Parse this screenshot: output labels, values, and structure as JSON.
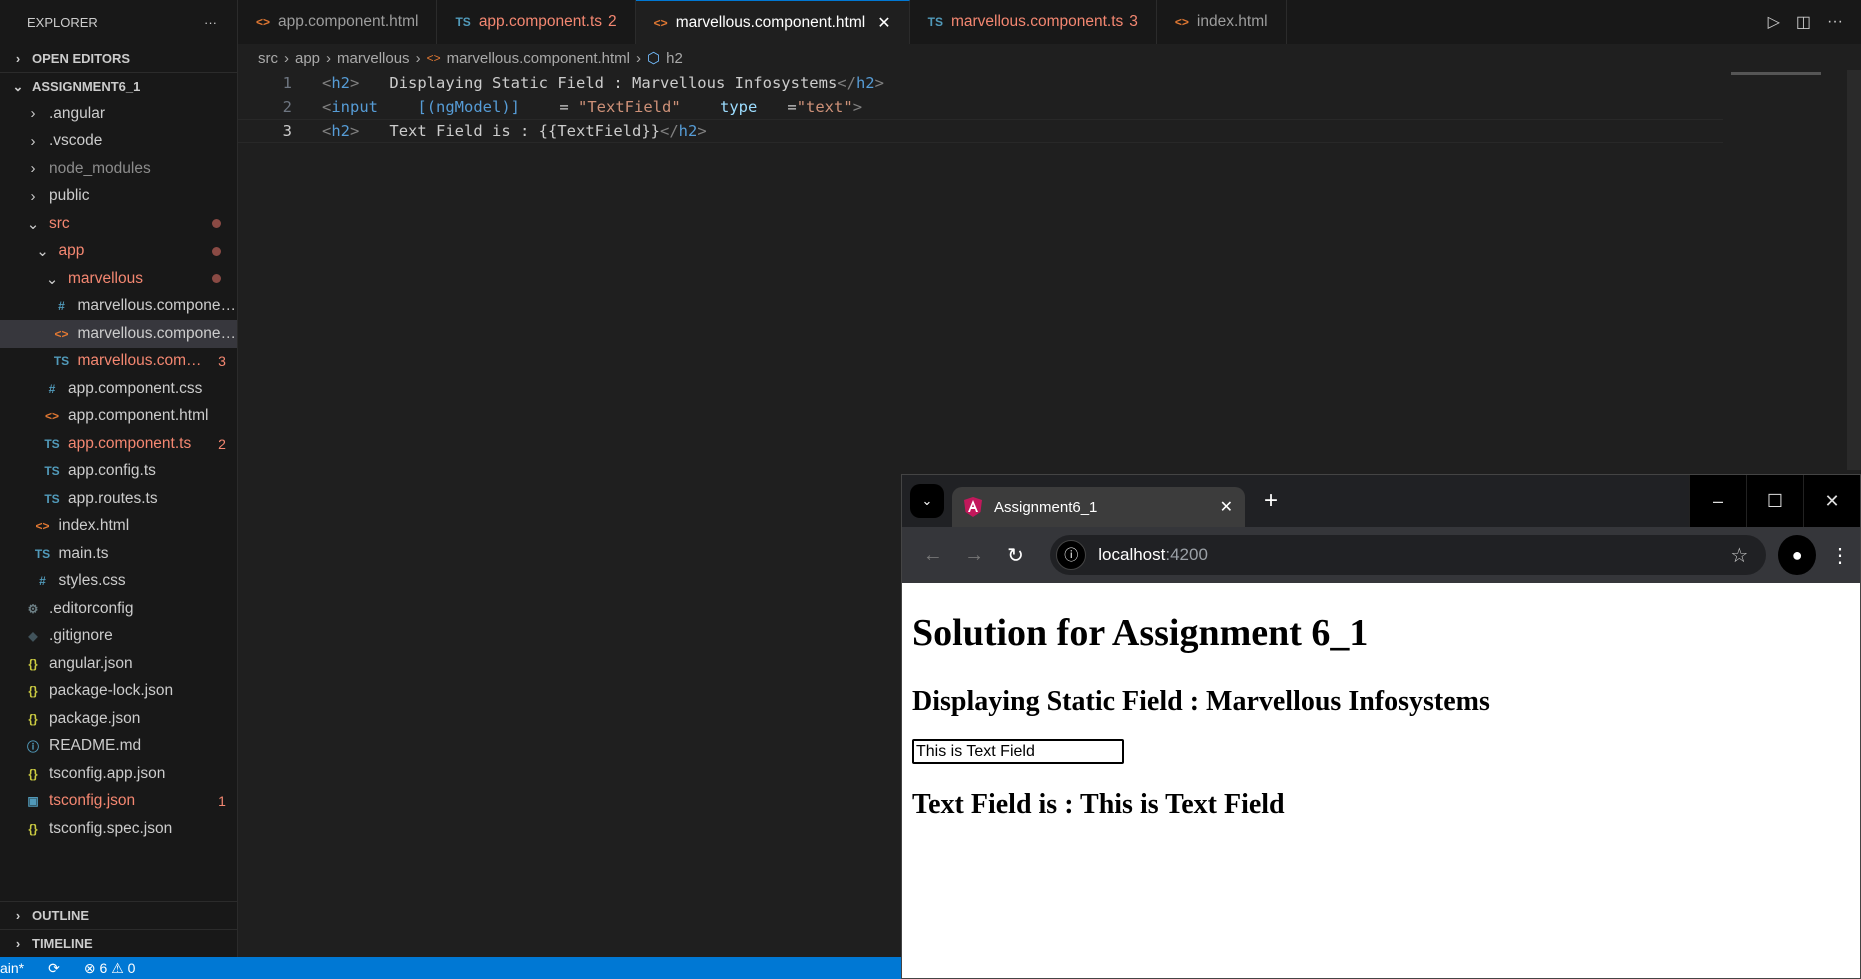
{
  "explorer": {
    "title": "EXPLORER",
    "more": "···",
    "open_editors": "OPEN EDITORS",
    "project": "ASSIGNMENT6_1",
    "outline": "OUTLINE",
    "timeline": "TIMELINE",
    "items": [
      {
        "label": ".angular",
        "level": 0,
        "kind": "folder",
        "open": false,
        "state": ""
      },
      {
        "label": ".vscode",
        "level": 0,
        "kind": "folder",
        "open": false,
        "state": ""
      },
      {
        "label": "node_modules",
        "level": 0,
        "kind": "folder",
        "open": false,
        "state": "dim"
      },
      {
        "label": "public",
        "level": 0,
        "kind": "folder",
        "open": false,
        "state": ""
      },
      {
        "label": "src",
        "level": 0,
        "kind": "folder",
        "open": true,
        "state": "err",
        "dot": true
      },
      {
        "label": "app",
        "level": 1,
        "kind": "folder",
        "open": true,
        "state": "err",
        "dot": true
      },
      {
        "label": "marvellous",
        "level": 2,
        "kind": "folder",
        "open": true,
        "state": "err",
        "dot": true
      },
      {
        "label": "marvellous.component.css",
        "level": 3,
        "kind": "css",
        "state": ""
      },
      {
        "label": "marvellous.component.html",
        "level": 3,
        "kind": "html",
        "state": "",
        "selected": true
      },
      {
        "label": "marvellous.component.ts",
        "level": 3,
        "kind": "ts",
        "state": "err",
        "badge": "3"
      },
      {
        "label": "app.component.css",
        "level": 2,
        "kind": "css",
        "state": ""
      },
      {
        "label": "app.component.html",
        "level": 2,
        "kind": "html",
        "state": ""
      },
      {
        "label": "app.component.ts",
        "level": 2,
        "kind": "ts",
        "state": "err",
        "badge": "2"
      },
      {
        "label": "app.config.ts",
        "level": 2,
        "kind": "ts",
        "state": ""
      },
      {
        "label": "app.routes.ts",
        "level": 2,
        "kind": "ts",
        "state": ""
      },
      {
        "label": "index.html",
        "level": 1,
        "kind": "html",
        "state": ""
      },
      {
        "label": "main.ts",
        "level": 1,
        "kind": "ts",
        "state": ""
      },
      {
        "label": "styles.css",
        "level": 1,
        "kind": "css",
        "state": ""
      },
      {
        "label": ".editorconfig",
        "level": 0,
        "kind": "gear",
        "state": ""
      },
      {
        "label": ".gitignore",
        "level": 0,
        "kind": "git",
        "state": ""
      },
      {
        "label": "angular.json",
        "level": 0,
        "kind": "json",
        "state": ""
      },
      {
        "label": "package-lock.json",
        "level": 0,
        "kind": "json",
        "state": ""
      },
      {
        "label": "package.json",
        "level": 0,
        "kind": "json",
        "state": ""
      },
      {
        "label": "README.md",
        "level": 0,
        "kind": "info",
        "state": ""
      },
      {
        "label": "tsconfig.app.json",
        "level": 0,
        "kind": "json",
        "state": ""
      },
      {
        "label": "tsconfig.json",
        "level": 0,
        "kind": "tsconfig",
        "state": "err",
        "badge": "1"
      },
      {
        "label": "tsconfig.spec.json",
        "level": 0,
        "kind": "json",
        "state": ""
      }
    ]
  },
  "tabs": [
    {
      "label": "app.component.html",
      "kind": "html",
      "state": ""
    },
    {
      "label": "app.component.ts",
      "kind": "ts",
      "state": "err",
      "badge": "2"
    },
    {
      "label": "marvellous.component.html",
      "kind": "html",
      "state": "active"
    },
    {
      "label": "marvellous.component.ts",
      "kind": "ts",
      "state": "err",
      "badge": "3"
    },
    {
      "label": "index.html",
      "kind": "html",
      "state": ""
    }
  ],
  "breadcrumb": [
    "src",
    "app",
    "marvellous",
    "marvellous.component.html",
    "h2"
  ],
  "code": [
    [
      [
        "tg",
        "<"
      ],
      [
        "tn",
        "h2"
      ],
      [
        "tg",
        ">"
      ],
      [
        "c",
        "Displaying Static Field : Marvellous Infosystems"
      ],
      [
        "tg",
        "</"
      ],
      [
        "tn",
        "h2"
      ],
      [
        "tg",
        ">"
      ]
    ],
    [
      [
        "tg",
        "<"
      ],
      [
        "tn",
        "input"
      ],
      [
        "c",
        " "
      ],
      [
        "tn",
        "[(ngModel)]"
      ],
      [
        "c",
        " = "
      ],
      [
        "st",
        "\"TextField\""
      ],
      [
        "c",
        " "
      ],
      [
        "at",
        "type"
      ],
      [
        "c",
        "="
      ],
      [
        "st",
        "\"text\""
      ],
      [
        "tg",
        ">"
      ]
    ],
    [
      [
        "tg",
        "<"
      ],
      [
        "tn",
        "h2"
      ],
      [
        "tg",
        ">"
      ],
      [
        "c",
        "Text Field is : {{TextField}}"
      ],
      [
        "tg",
        "</"
      ],
      [
        "tn",
        "h2"
      ],
      [
        "tg",
        ">"
      ]
    ]
  ],
  "status": {
    "branch": "ain*",
    "errors": "6",
    "warnings": "0"
  },
  "browser": {
    "tab_title": "Assignment6_1",
    "host": "localhost",
    "port": ":4200",
    "page": {
      "h1": "Solution for Assignment 6_1",
      "h2": "Displaying Static Field : Marvellous Infosystems",
      "input_value": "This is Text Field",
      "result": "Text Field is : This is Text Field"
    }
  },
  "colors": {
    "accent": "#0078d4",
    "error": "#f48771",
    "status_bar": "#0078d4"
  }
}
